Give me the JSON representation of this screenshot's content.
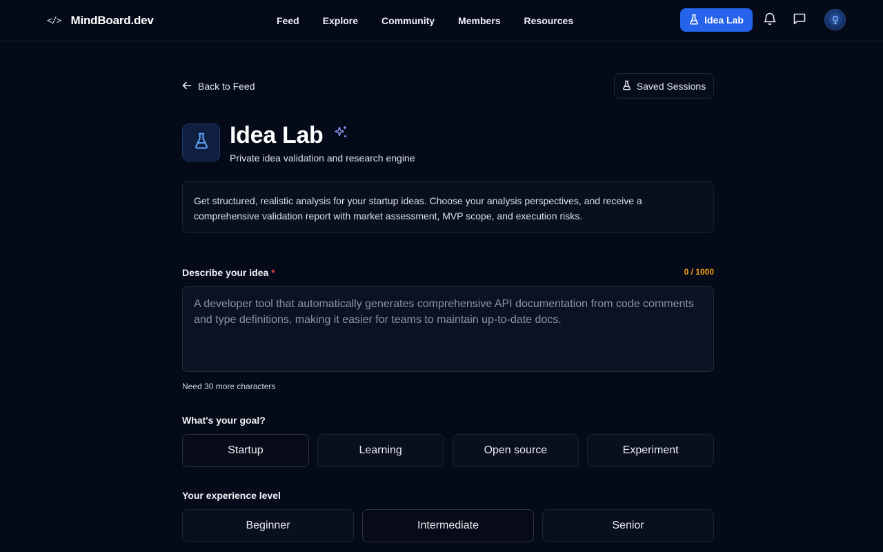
{
  "header": {
    "brand_icon": "</>",
    "brand_name": "MindBoard.dev",
    "nav": [
      "Feed",
      "Explore",
      "Community",
      "Members",
      "Resources"
    ],
    "idea_lab_button": "Idea Lab",
    "accent_color": "#2563eb",
    "icons": [
      "flask-icon",
      "bell-icon",
      "message-icon",
      "avatar"
    ]
  },
  "main": {
    "back_link": "Back to Feed",
    "saved_sessions": "Saved Sessions",
    "title": "Idea Lab",
    "subtitle": "Private idea validation and research engine",
    "intro": "Get structured, realistic analysis for your startup ideas. Choose your analysis perspectives, and receive a comprehensive validation report with market assessment, MVP scope, and execution risks.",
    "idea": {
      "label": "Describe your idea",
      "required_mark": "*",
      "char_count": "0 / 1000",
      "value": "",
      "placeholder": "A developer tool that automatically generates comprehensive API documentation from code comments and type definitions, making it easier for teams to maintain up-to-date docs.",
      "hint": "Need 30 more characters"
    },
    "goal": {
      "label": "What's your goal?",
      "options": [
        "Startup",
        "Learning",
        "Open source",
        "Experiment"
      ],
      "selected": "Startup"
    },
    "experience": {
      "label": "Your experience level",
      "options": [
        "Beginner",
        "Intermediate",
        "Senior"
      ],
      "selected": "Intermediate"
    }
  }
}
